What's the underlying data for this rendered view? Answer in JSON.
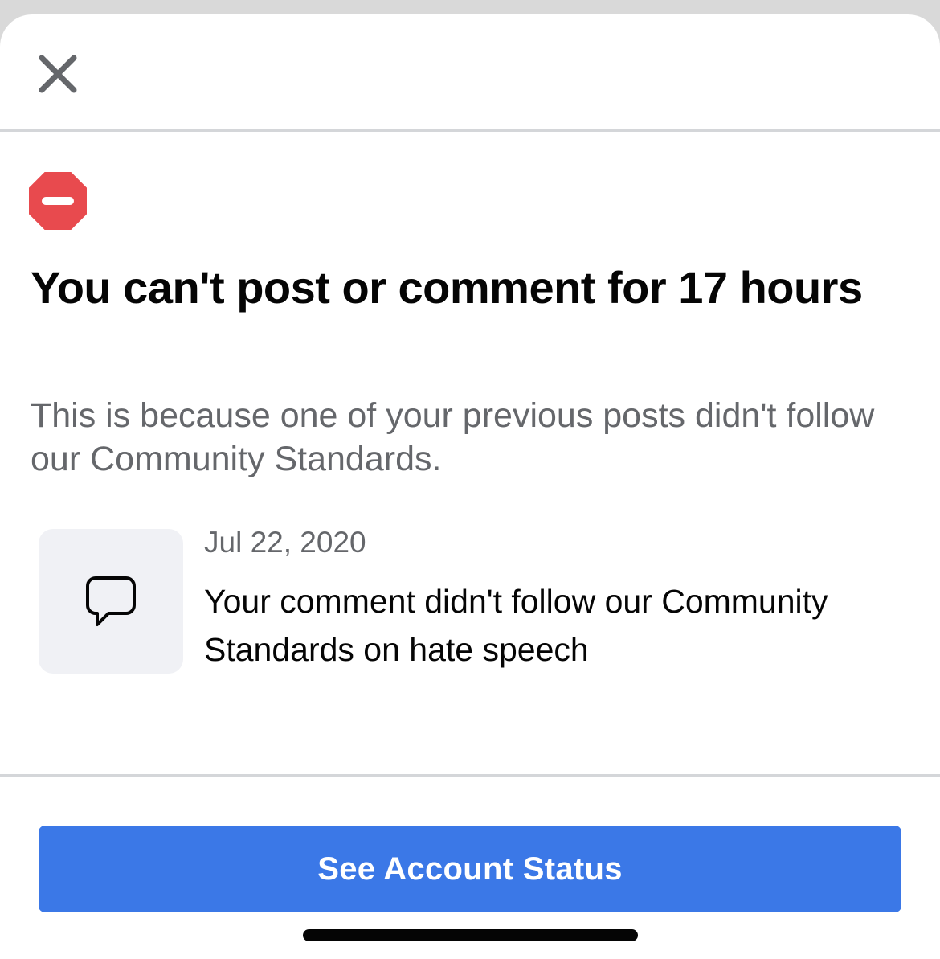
{
  "header": {
    "close_icon": "close-icon",
    "close_label": "Close"
  },
  "notice": {
    "status_icon": "stop-sign-icon",
    "status_color": "#e84a4e",
    "title": "You can't post or comment for 17 hours",
    "subtitle": "This is because one of your previous posts didn't follow our Community Standards."
  },
  "violation": {
    "icon": "comment-bubble-icon",
    "date": "Jul 22, 2020",
    "description": "Your comment didn't follow our Community Standards on hate speech"
  },
  "footer": {
    "button_label": "See Account Status",
    "button_color": "#3b78e7"
  }
}
